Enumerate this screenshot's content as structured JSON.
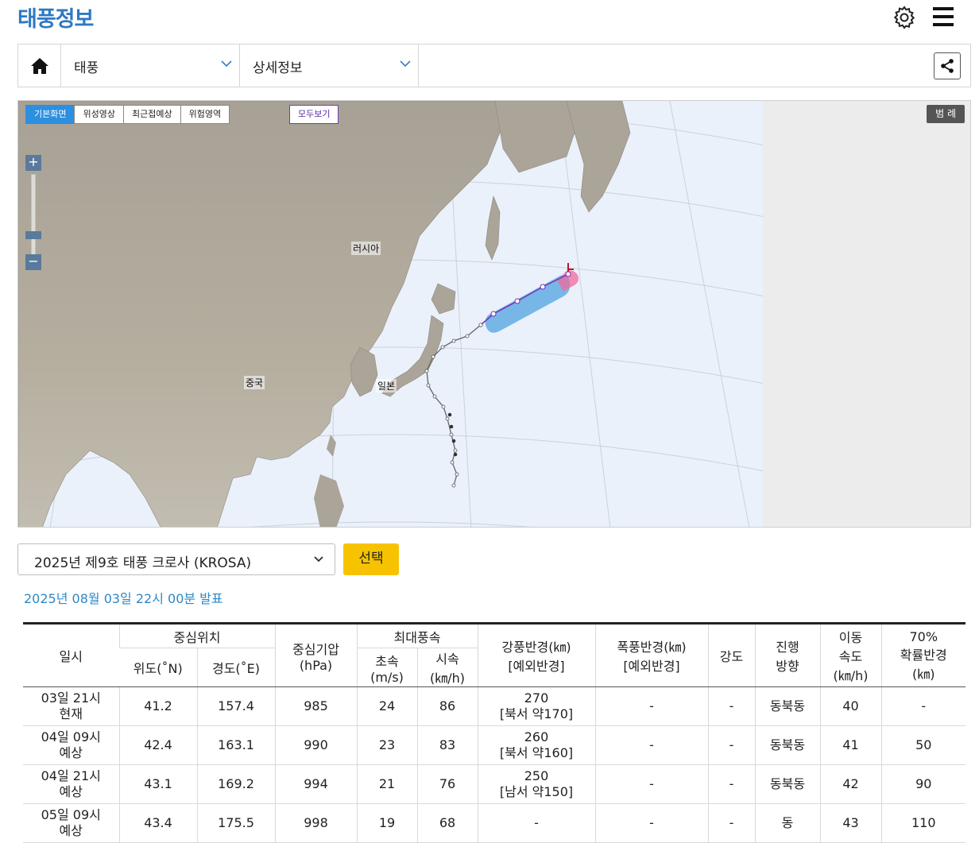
{
  "header": {
    "title": "태풍정보",
    "settings_icon": "gear-icon",
    "menu_icon": "hamburger-menu-icon"
  },
  "nav": {
    "home_icon": "home-icon",
    "select1": "태풍",
    "select2": "상세정보",
    "share_icon": "share-icon"
  },
  "map": {
    "tabs": [
      "기본화면",
      "위성영상",
      "최근접예상",
      "위험영역"
    ],
    "active_tab": "기본화면",
    "all_view": "모두보기",
    "legend": "범 례",
    "zoom_in": "+",
    "zoom_out": "−",
    "labels": {
      "russia": "러시아",
      "china": "중국",
      "japan": "일본"
    },
    "colors": {
      "sea": "#eaf1fb",
      "land": "#aea89d",
      "gale_radius": "#4fa3e0",
      "forecast_track": "#7a2fb5",
      "past_track": "#666666"
    }
  },
  "storm_select": {
    "value": "2025년 제9호 태풍 크로사 (KROSA)",
    "button": "선택"
  },
  "issued": "2025년 08월 03일 22시 00분 발표",
  "table": {
    "headers": {
      "time": "일시",
      "center": "중심위치",
      "lat": "위도(˚N)",
      "lon": "경도(˚E)",
      "pressure_1": "중심기압",
      "pressure_2": "(hPa)",
      "maxwind": "최대풍속",
      "ms_1": "초속",
      "ms_2": "(m/s)",
      "kmh_1": "시속",
      "kmh_2": "(㎞/h)",
      "gale_1": "강풍반경(㎞)",
      "gale_2": "[예외반경]",
      "storm_1": "폭풍반경(㎞)",
      "storm_2": "[예외반경]",
      "intensity": "강도",
      "dir_1": "진행",
      "dir_2": "방향",
      "speed_1": "이동",
      "speed_2": "속도",
      "speed_3": "(㎞/h)",
      "prob_1": "70%",
      "prob_2": "확률반경",
      "prob_3": "(㎞)"
    },
    "rows": [
      {
        "time1": "03일 21시",
        "time2": "현재",
        "lat": "41.2",
        "lon": "157.4",
        "pressure": "985",
        "ms": "24",
        "kmh": "86",
        "gale1": "270",
        "gale2": "[북서 약170]",
        "storm": "-",
        "intensity": "-",
        "dir": "동북동",
        "speed": "40",
        "prob": "-"
      },
      {
        "time1": "04일 09시",
        "time2": "예상",
        "lat": "42.4",
        "lon": "163.1",
        "pressure": "990",
        "ms": "23",
        "kmh": "83",
        "gale1": "260",
        "gale2": "[북서 약160]",
        "storm": "-",
        "intensity": "-",
        "dir": "동북동",
        "speed": "41",
        "prob": "50"
      },
      {
        "time1": "04일 21시",
        "time2": "예상",
        "lat": "43.1",
        "lon": "169.2",
        "pressure": "994",
        "ms": "21",
        "kmh": "76",
        "gale1": "250",
        "gale2": "[남서 약150]",
        "storm": "-",
        "intensity": "-",
        "dir": "동북동",
        "speed": "42",
        "prob": "90"
      },
      {
        "time1": "05일 09시",
        "time2": "예상",
        "lat": "43.4",
        "lon": "175.5",
        "pressure": "998",
        "ms": "19",
        "kmh": "68",
        "gale1": "-",
        "gale2": "",
        "storm": "-",
        "intensity": "-",
        "dir": "동",
        "speed": "43",
        "prob": "110"
      }
    ]
  }
}
